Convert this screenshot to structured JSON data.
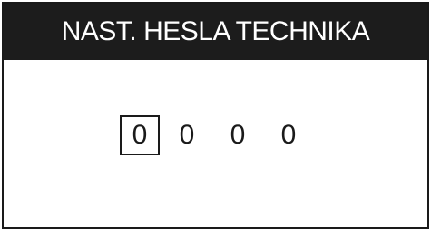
{
  "screen": {
    "title": "NAST. HESLA TECHNIKA"
  },
  "password": {
    "digits": [
      "0",
      "0",
      "0",
      "0"
    ],
    "selected_index": 0
  }
}
